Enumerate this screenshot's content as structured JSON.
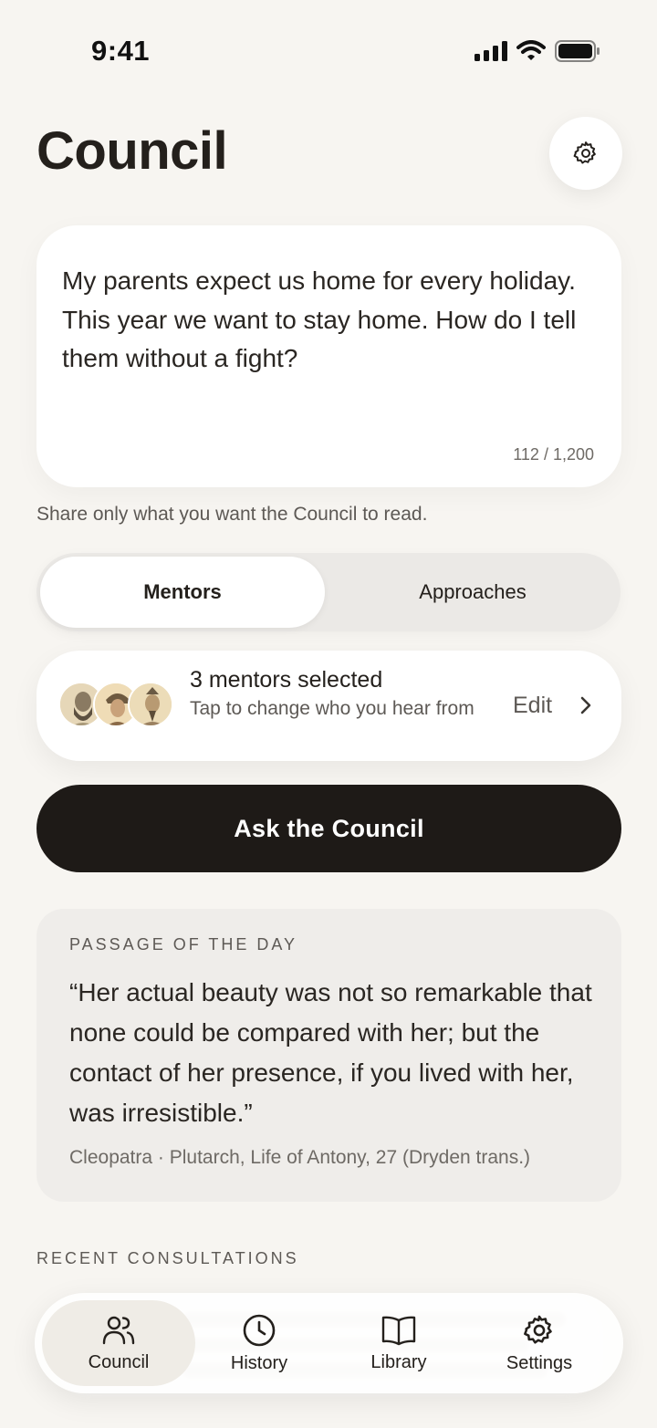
{
  "status_bar": {
    "time": "9:41",
    "icons": [
      "cellular-signal-icon",
      "wifi-icon",
      "battery-icon"
    ]
  },
  "header": {
    "title": "Council",
    "settings_icon": "gear-icon"
  },
  "question": {
    "text": "My parents expect us home for every holiday. This year we want to stay home. How do I tell them without a fight?",
    "char_count": "112 / 1,200",
    "hint": "Share only what you want the Council to read."
  },
  "segmented": {
    "options": [
      "Mentors",
      "Approaches"
    ],
    "selected": "Mentors"
  },
  "mentors": {
    "title": "3 mentors selected",
    "subtitle": "Tap to change who you hear from",
    "edit_label": "Edit"
  },
  "ask_button": {
    "label": "Ask the Council"
  },
  "passage": {
    "label": "PASSAGE OF THE DAY",
    "quote": "“Her actual beauty was not so remarkable that none could be compared with her; but the contact of her presence, if you lived with her, was irresistible.”",
    "source": "Cleopatra · Plutarch, Life of Antony, 27 (Dryden trans.)"
  },
  "recent": {
    "label": "RECENT CONSULTATIONS"
  },
  "tabbar": {
    "tabs": [
      {
        "label": "Council",
        "icon": "people-icon",
        "active": true
      },
      {
        "label": "History",
        "icon": "clock-icon",
        "active": false
      },
      {
        "label": "Library",
        "icon": "book-icon",
        "active": false
      },
      {
        "label": "Settings",
        "icon": "gear-icon",
        "active": false
      }
    ]
  },
  "colors": {
    "background": "#f7f5f1",
    "card": "#ffffff",
    "primary_button": "#1e1a17",
    "text": "#24201c",
    "muted_text": "#5d5955"
  }
}
